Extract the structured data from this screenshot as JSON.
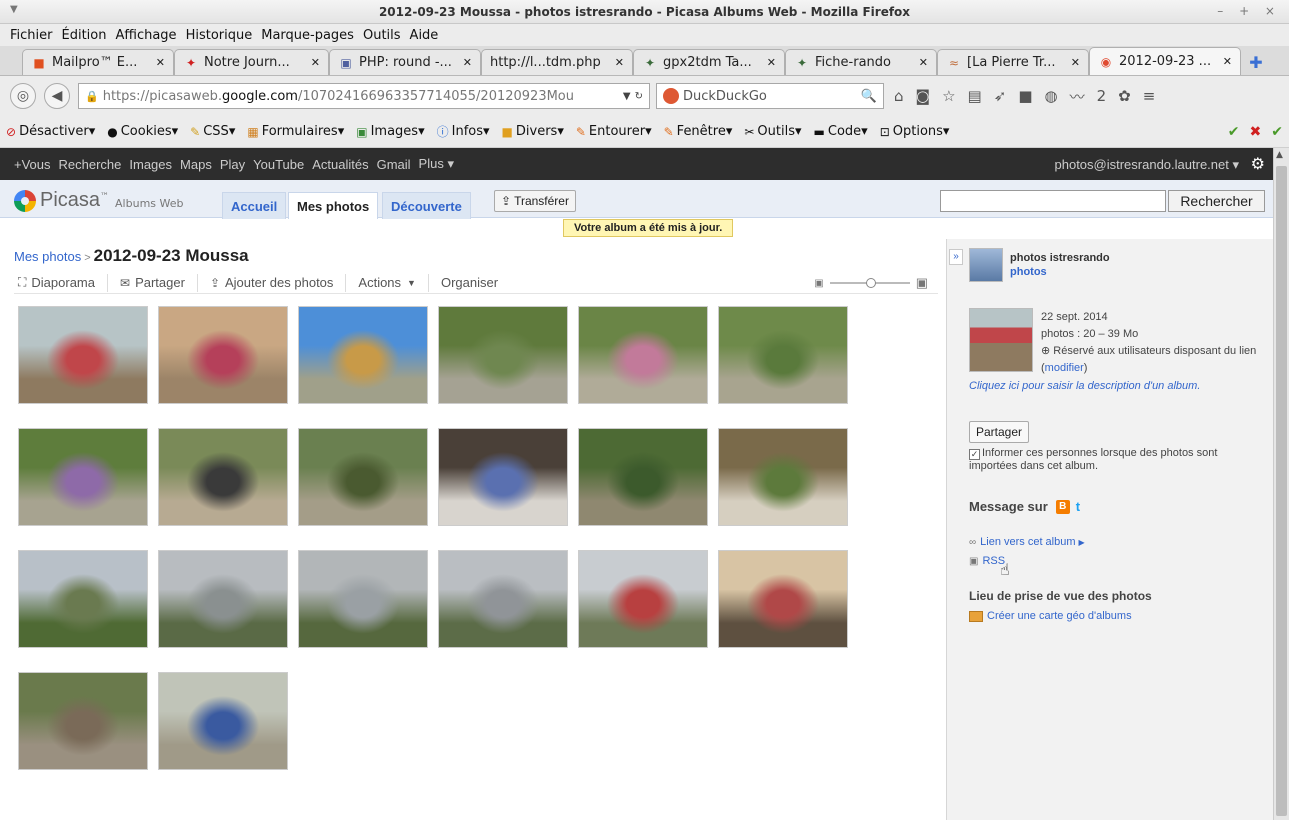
{
  "window": {
    "title": "2012-09-23 Moussa - photos istresrando - Picasa Albums Web - Mozilla Firefox"
  },
  "menu": [
    "Fichier",
    "Édition",
    "Affichage",
    "Historique",
    "Marque-pages",
    "Outils",
    "Aide"
  ],
  "tabs": [
    {
      "label": "Mailpro™ E...",
      "icon": "mailpro-icon"
    },
    {
      "label": "Notre Journ...",
      "icon": "hiker-icon"
    },
    {
      "label": "PHP: round -...",
      "icon": "php-icon"
    },
    {
      "label": "http://l...tdm.php",
      "icon": ""
    },
    {
      "label": "gpx2tdm Ta...",
      "icon": "hiker-icon"
    },
    {
      "label": "Fiche-rando",
      "icon": "hiker-icon"
    },
    {
      "label": "[La Pierre Tr...",
      "icon": "stone-icon"
    },
    {
      "label": "2012-09-23 ...",
      "icon": "picasa-icon"
    }
  ],
  "nav": {
    "url_prefix": "https://picasaweb.",
    "url_domain": "google.com",
    "url_rest": "/107024166963357714055/20120923Mou",
    "search_placeholder": "DuckDuckGo",
    "badge_count": "2"
  },
  "bookmarks": [
    "Désactiver",
    "Cookies",
    "CSS",
    "Formulaires",
    "Images",
    "Infos",
    "Divers",
    "Entourer",
    "Fenêtre",
    "Outils",
    "Code",
    "Options"
  ],
  "gbar": {
    "links": [
      "+Vous",
      "Recherche",
      "Images",
      "Maps",
      "Play",
      "YouTube",
      "Actualités",
      "Gmail",
      "Plus"
    ],
    "user": "photos@istresrando.lautre.net"
  },
  "picasa": {
    "logo_name": "Picasa",
    "logo_sub": "Albums Web",
    "tabs": [
      "Accueil",
      "Mes photos",
      "Découverte"
    ],
    "upload": "Transférer",
    "search_button": "Rechercher",
    "notice": "Votre album a été mis à jour."
  },
  "album": {
    "crumb_link": "Mes photos",
    "title": "2012-09-23 Moussa",
    "actions": [
      "Diaporama",
      "Partager",
      "Ajouter des photos",
      "Actions",
      "Organiser"
    ]
  },
  "photos": [
    {
      "sky": "#b7c4c6",
      "ground": "#8e7a60",
      "accent": "#c0464a"
    },
    {
      "sky": "#c9a783",
      "ground": "#9c8468",
      "accent": "#b5405a"
    },
    {
      "sky": "#4d8fd8",
      "ground": "#a0a08a",
      "accent": "#c89a48"
    },
    {
      "sky": "#5f7a3c",
      "ground": "#a5a293",
      "accent": "#6f8750"
    },
    {
      "sky": "#6a8546",
      "ground": "#b0ab98",
      "accent": "#c27a9a"
    },
    {
      "sky": "#6e8a4a",
      "ground": "#a8a48f",
      "accent": "#5a7a3c"
    },
    {
      "sky": "#5e7d3c",
      "ground": "#a7a390",
      "accent": "#8e6aa8"
    },
    {
      "sky": "#7a8a58",
      "ground": "#b7aa92",
      "accent": "#3a3a3a"
    },
    {
      "sky": "#6a8050",
      "ground": "#a49d88",
      "accent": "#4a5a30"
    },
    {
      "sky": "#4a4038",
      "ground": "#d8d4ce",
      "accent": "#5a70b0"
    },
    {
      "sky": "#4d6a34",
      "ground": "#8f8870",
      "accent": "#3c5a2c"
    },
    {
      "sky": "#7a6a4a",
      "ground": "#d6cfc0",
      "accent": "#5d7a3c"
    },
    {
      "sky": "#b8c0c8",
      "ground": "#4f6a34",
      "accent": "#6a7a50"
    },
    {
      "sky": "#b8bcc0",
      "ground": "#5a6a46",
      "accent": "#8a9090"
    },
    {
      "sky": "#b2b6b8",
      "ground": "#56683e",
      "accent": "#9aa0a4"
    },
    {
      "sky": "#babec2",
      "ground": "#5c6c48",
      "accent": "#909498"
    },
    {
      "sky": "#c8ccd0",
      "ground": "#6e7a58",
      "accent": "#b84040"
    },
    {
      "sky": "#d8c4a4",
      "ground": "#5e5040",
      "accent": "#b04848"
    },
    {
      "sky": "#6a7a4c",
      "ground": "#9a9080",
      "accent": "#7a6a58"
    },
    {
      "sky": "#c0c4b8",
      "ground": "#a09a88",
      "accent": "#3a5aa0"
    }
  ],
  "sidebar": {
    "owner": "photos istresrando",
    "owner_link": "photos",
    "date": "22 sept. 2014",
    "photos_info": "photos : 20 – 39 Mo",
    "access_text": "Réservé aux utilisateurs disposant du lien",
    "modify_link": "modifier",
    "description_link": "Cliquez ici pour saisir la description d'un album.",
    "share_button": "Partager",
    "notify_text": "Informer ces personnes lorsque des photos sont importées dans cet album.",
    "message_label": "Message sur",
    "album_link": "Lien vers cet album",
    "rss_link": "RSS",
    "location_title": "Lieu de prise de vue des photos",
    "map_link": "Créer une carte géo d'albums"
  }
}
